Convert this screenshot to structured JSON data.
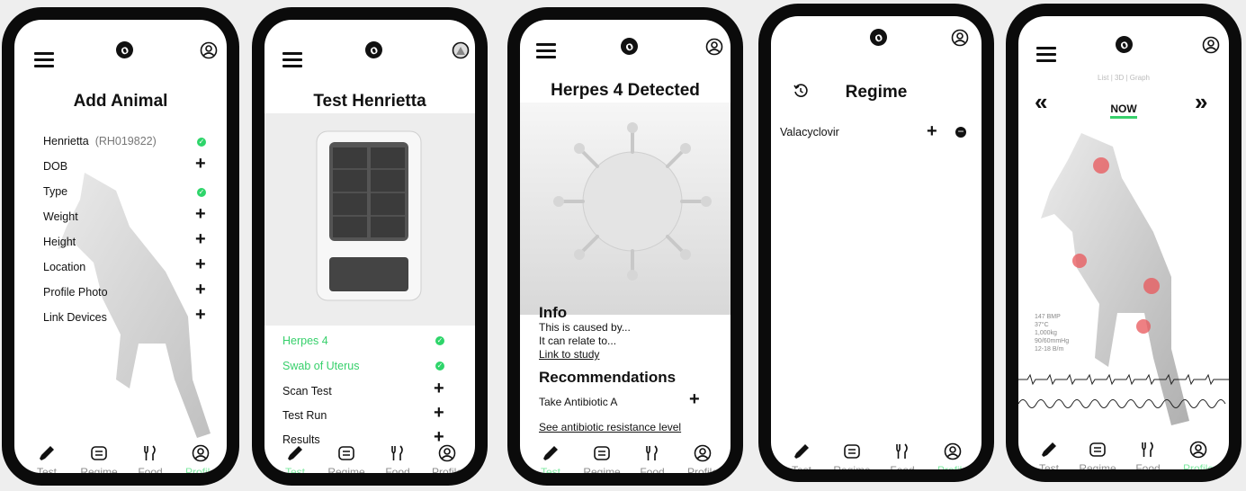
{
  "screens": [
    {
      "title": "Add Animal",
      "fields": [
        {
          "label": "Henrietta",
          "extra": "(RH019822)",
          "state": "check"
        },
        {
          "label": "DOB",
          "state": "plus"
        },
        {
          "label": "Type",
          "state": "check"
        },
        {
          "label": "Weight",
          "state": "plus"
        },
        {
          "label": "Height",
          "state": "plus"
        },
        {
          "label": "Location",
          "state": "plus"
        },
        {
          "label": "Profile Photo",
          "state": "plus"
        },
        {
          "label": "Link Devices",
          "state": "plus"
        }
      ],
      "active_tab": "Profile"
    },
    {
      "title": "Test Henrietta",
      "steps": [
        {
          "label": "Herpes 4",
          "state": "check",
          "done": true
        },
        {
          "label": "Swab of Uterus",
          "state": "check",
          "done": true
        },
        {
          "label": "Scan Test",
          "state": "plus",
          "done": false
        },
        {
          "label": "Test Run",
          "state": "plus",
          "done": false
        },
        {
          "label": "Results",
          "state": "plus",
          "done": false
        }
      ],
      "active_tab": "Test"
    },
    {
      "title": "Herpes 4 Detected",
      "info_heading": "Info",
      "info_lines": [
        "This is caused by...",
        "It can relate to..."
      ],
      "info_link": "Link to study",
      "rec_heading": "Recommendations",
      "rec_item": "Take Antibiotic A",
      "rec_link": "See antibiotic resistance level",
      "active_tab": "Test"
    },
    {
      "title": "Regime",
      "item": "Valacyclovir",
      "active_tab": "Profile"
    },
    {
      "view_toggle": "List | 3D | Graph",
      "now_label": "NOW",
      "prev_label": "«",
      "next_label": "»",
      "vitals": [
        "147 BMP",
        "37°C",
        "1,000kg",
        "90/60mmHg",
        "12-18 B/m"
      ],
      "active_tab": "Profile"
    }
  ],
  "nav_labels": [
    "Test",
    "Regime",
    "Food",
    "Profile"
  ],
  "colors": {
    "accent_green": "#37d06b",
    "nav_active": "#7de9a0",
    "hot_spot": "#e8555a"
  }
}
